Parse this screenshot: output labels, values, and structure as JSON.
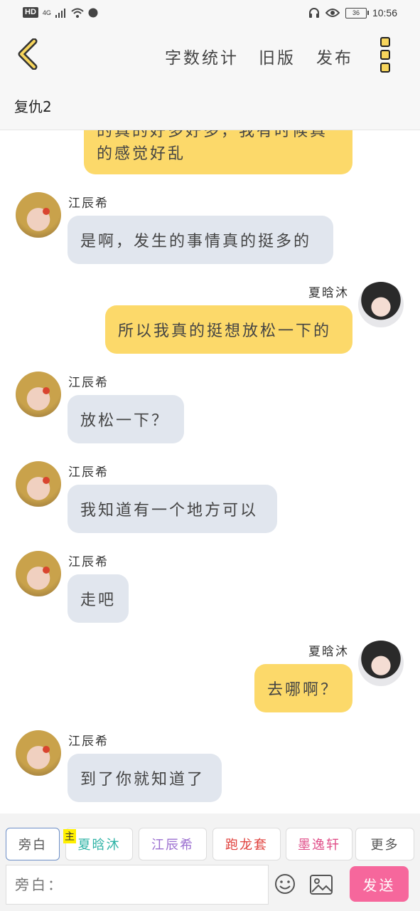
{
  "status_bar": {
    "hd": "HD",
    "network": "4G",
    "battery": "36",
    "time": "10:56"
  },
  "header": {
    "word_count": "字数统计",
    "old_version": "旧版",
    "publish": "发布"
  },
  "title": "复仇2",
  "messages": [
    {
      "side": "right",
      "sender": "",
      "text": "的真的好多好多，我有时候真"
    },
    {
      "side": "right",
      "sender": "",
      "text": "的感觉好乱"
    },
    {
      "side": "left",
      "sender": "江辰希",
      "text": "是啊，发生的事情真的挺多的"
    },
    {
      "side": "right",
      "sender": "夏晗沐",
      "text": "所以我真的挺想放松一下的"
    },
    {
      "side": "left",
      "sender": "江辰希",
      "text": "放松一下？"
    },
    {
      "side": "left",
      "sender": "江辰希",
      "text": "我知道有一个地方可以"
    },
    {
      "side": "left",
      "sender": "江辰希",
      "text": "走吧"
    },
    {
      "side": "right",
      "sender": "夏晗沐",
      "text": "去哪啊？"
    },
    {
      "side": "left",
      "sender": "江辰希",
      "text": "到了你就知道了"
    }
  ],
  "roles": [
    {
      "label": "旁白",
      "color": "#555555"
    },
    {
      "label": "夏晗沐",
      "color": "#2fb3a6"
    },
    {
      "label": "江辰希",
      "color": "#9b6fd0"
    },
    {
      "label": "跑龙套",
      "color": "#e0413c"
    },
    {
      "label": "墨逸轩",
      "color": "#e0508a"
    },
    {
      "label": "更多",
      "color": "#555555"
    }
  ],
  "main_badge": "主",
  "input": {
    "placeholder": "旁白："
  },
  "send_label": "发送",
  "icons": [
    "back-chevron-icon",
    "menu-dots-icon",
    "emoji-icon",
    "image-icon",
    "wifi-icon",
    "headphones-icon",
    "eye-icon"
  ]
}
